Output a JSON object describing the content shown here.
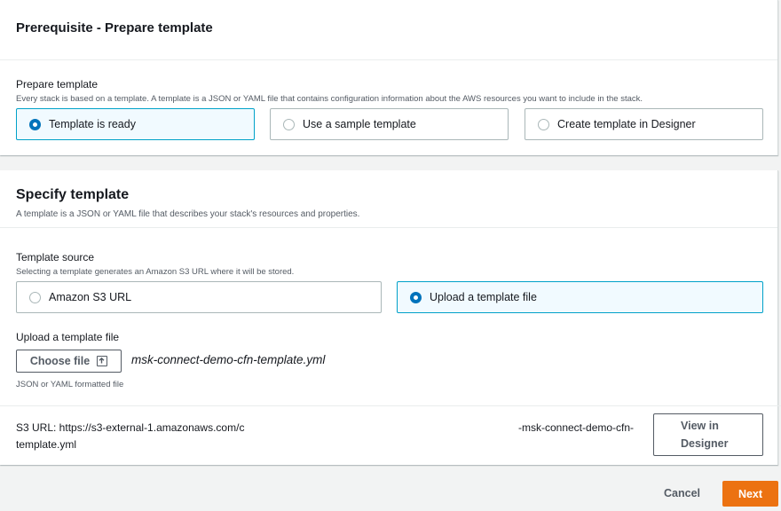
{
  "prepare_panel": {
    "title": "Prerequisite - Prepare template",
    "field_label": "Prepare template",
    "field_desc": "Every stack is based on a template. A template is a JSON or YAML file that contains configuration information about the AWS resources you want to include in the stack.",
    "options": [
      {
        "label": "Template is ready",
        "selected": true
      },
      {
        "label": "Use a sample template",
        "selected": false
      },
      {
        "label": "Create template in Designer",
        "selected": false
      }
    ]
  },
  "specify_panel": {
    "title": "Specify template",
    "desc": "A template is a JSON or YAML file that describes your stack's resources and properties.",
    "source_label": "Template source",
    "source_desc": "Selecting a template generates an Amazon S3 URL where it will be stored.",
    "source_options": [
      {
        "label": "Amazon S3 URL",
        "selected": false
      },
      {
        "label": "Upload a template file",
        "selected": true
      }
    ],
    "upload_label": "Upload a template file",
    "choose_file_label": "Choose file",
    "file_name": "msk-connect-demo-cfn-template.yml",
    "file_hint": "JSON or YAML formatted file",
    "s3_url_prefix": "S3 URL:  https://s3-external-1.amazonaws.com/c",
    "s3_url_mid": "-msk-connect-demo-cfn-",
    "s3_url_end": "template.yml",
    "view_designer_label": "View in\nDesigner"
  },
  "footer": {
    "cancel_label": "Cancel",
    "next_label": "Next"
  },
  "colors": {
    "accent": "#0073bb",
    "selected_bg": "#f1faff",
    "primary_button": "#ec7211"
  }
}
